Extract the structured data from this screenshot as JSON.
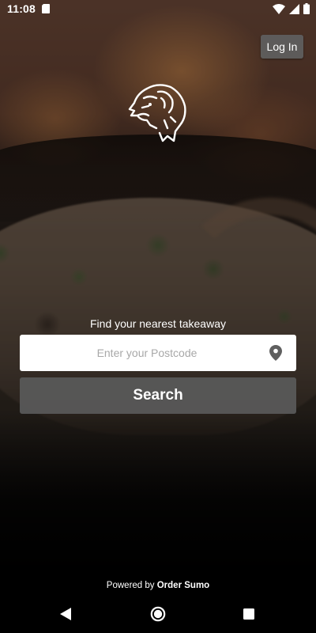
{
  "status_bar": {
    "time": "11:08",
    "icons": [
      "sd-card-icon",
      "wifi-icon",
      "signal-icon",
      "battery-icon"
    ]
  },
  "header": {
    "login_label": "Log In"
  },
  "logo": {
    "icon": "gorilla-logo-icon"
  },
  "search": {
    "tagline": "Find your nearest takeaway",
    "postcode_placeholder": "Enter your Postcode",
    "postcode_value": "",
    "location_icon": "location-pin-icon",
    "search_label": "Search"
  },
  "footer": {
    "powered_prefix": "Powered by",
    "powered_brand": "Order Sumo"
  },
  "nav_bar": {
    "buttons": [
      "back-icon",
      "home-icon",
      "recents-icon"
    ]
  },
  "colors": {
    "button_grey": "#585858",
    "field_background": "#ffffff",
    "placeholder_grey": "#a8a8a8",
    "text_white": "#ffffff"
  }
}
